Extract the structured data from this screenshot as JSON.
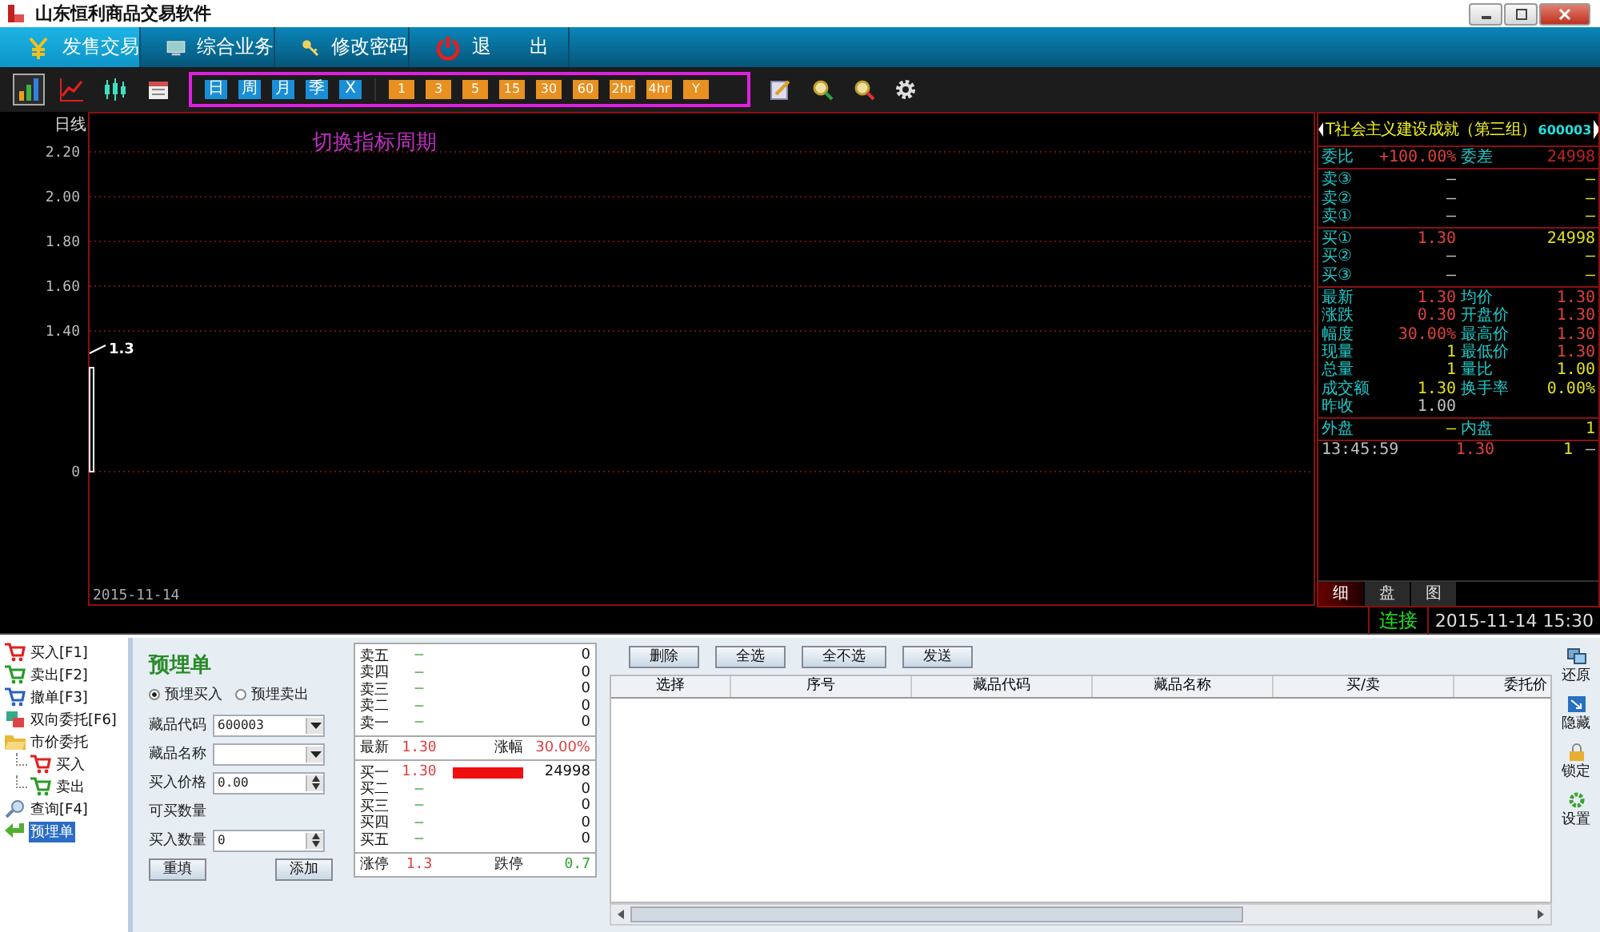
{
  "window": {
    "title": "山东恒利商品交易软件"
  },
  "menu_tabs": [
    {
      "label": "发售交易",
      "kind": "yen",
      "selected": true
    },
    {
      "label": "综合业务",
      "kind": "monitor",
      "selected": false
    },
    {
      "label": "修改密码",
      "kind": "key",
      "selected": false
    },
    {
      "label": "退　　出",
      "kind": "power",
      "selected": false
    }
  ],
  "chart_tools": [
    {
      "kind": "bars",
      "selected": true
    },
    {
      "kind": "line",
      "selected": false
    },
    {
      "kind": "candles",
      "selected": false
    },
    {
      "kind": "calendar",
      "selected": false
    }
  ],
  "periods": [
    {
      "label": "日",
      "kind": "date"
    },
    {
      "label": "周",
      "kind": "date"
    },
    {
      "label": "月",
      "kind": "date"
    },
    {
      "label": "季",
      "kind": "date"
    },
    {
      "label": "X",
      "kind": "date"
    },
    {
      "label": "1",
      "kind": "minute"
    },
    {
      "label": "3",
      "kind": "minute"
    },
    {
      "label": "5",
      "kind": "minute"
    },
    {
      "label": "15",
      "kind": "minute"
    },
    {
      "label": "30",
      "kind": "minute"
    },
    {
      "label": "60",
      "kind": "minute"
    },
    {
      "label": "2hr",
      "kind": "minute"
    },
    {
      "label": "4hr",
      "kind": "minute"
    },
    {
      "label": "Y",
      "kind": "minute"
    }
  ],
  "chart": {
    "period_label": "日线",
    "annotation": "切换指标周期",
    "y_labels": [
      "2.20",
      "2.00",
      "1.80",
      "1.60",
      "1.40",
      "0"
    ],
    "price_label": "1.3",
    "date_label": "2015-11-14"
  },
  "quote": {
    "name": "T社会主义建设成就（第三组）",
    "code": "600003",
    "sections": [
      [
        {
          "label": "委比",
          "value": {
            "text": "+100.00%",
            "kind": "price"
          },
          "label2": "委差",
          "value2": {
            "text": "24998",
            "kind": "diff"
          }
        }
      ],
      [
        {
          "label": "卖③",
          "value": {
            "text": "—",
            "kind": "plain"
          },
          "value2": {
            "text": "—",
            "kind": "volume"
          }
        },
        {
          "label": "卖②",
          "value": {
            "text": "—",
            "kind": "plain"
          },
          "value2": {
            "text": "—",
            "kind": "volume"
          }
        },
        {
          "label": "卖①",
          "value": {
            "text": "—",
            "kind": "plain"
          },
          "value2": {
            "text": "—",
            "kind": "volume"
          }
        }
      ],
      [
        {
          "label": "买①",
          "value": {
            "text": "1.30",
            "kind": "price"
          },
          "value2": {
            "text": "24998",
            "kind": "volume"
          }
        },
        {
          "label": "买②",
          "value": {
            "text": "—",
            "kind": "plain"
          },
          "value2": {
            "text": "—",
            "kind": "volume"
          }
        },
        {
          "label": "买③",
          "value": {
            "text": "—",
            "kind": "plain"
          },
          "value2": {
            "text": "—",
            "kind": "volume"
          }
        }
      ],
      [
        {
          "label": "最新",
          "value": {
            "text": "1.30",
            "kind": "price"
          },
          "label2": "均价",
          "value2": {
            "text": "1.30",
            "kind": "price"
          }
        },
        {
          "label": "涨跌",
          "value": {
            "text": "0.30",
            "kind": "price"
          },
          "label2": "开盘价",
          "value2": {
            "text": "1.30",
            "kind": "price"
          }
        },
        {
          "label": "幅度",
          "value": {
            "text": "30.00%",
            "kind": "price"
          },
          "label2": "最高价",
          "value2": {
            "text": "1.30",
            "kind": "price"
          }
        },
        {
          "label": "现量",
          "value": {
            "text": "1",
            "kind": "volume"
          },
          "label2": "最低价",
          "value2": {
            "text": "1.30",
            "kind": "price"
          }
        },
        {
          "label": "总量",
          "value": {
            "text": "1",
            "kind": "volume"
          },
          "label2": "量比",
          "value2": {
            "text": "1.00",
            "kind": "volume"
          }
        },
        {
          "label": "成交额",
          "value": {
            "text": "1.30",
            "kind": "volume"
          },
          "label2": "换手率",
          "value2": {
            "text": "0.00%",
            "kind": "volume"
          }
        },
        {
          "label": "昨收",
          "value": {
            "text": "1.00",
            "kind": "plain"
          }
        }
      ],
      [
        {
          "label": "外盘",
          "value": {
            "text": "—",
            "kind": "volume"
          },
          "label2": "内盘",
          "value2": {
            "text": "1",
            "kind": "volume"
          }
        }
      ]
    ],
    "ticks": [
      {
        "time": "13:45:59",
        "price": "1.30",
        "volume": "1",
        "flag": "—"
      }
    ],
    "tabs": [
      {
        "label": "细",
        "selected": true
      },
      {
        "label": "盘",
        "selected": false
      },
      {
        "label": "图",
        "selected": false
      }
    ]
  },
  "status": {
    "connection": "连接",
    "datetime": "2015-11-14 15:30"
  },
  "nav": [
    {
      "label": "买入[F1]",
      "kind": "cart-buy",
      "selected": false
    },
    {
      "label": "卖出[F2]",
      "kind": "cart-sell",
      "selected": false
    },
    {
      "label": "撤单[F3]",
      "kind": "cart-cancel",
      "selected": false
    },
    {
      "label": "双向委托[F6]",
      "kind": "swap",
      "selected": false
    },
    {
      "label": "市价委托",
      "kind": "folder",
      "selected": false,
      "expanded": true,
      "children": [
        {
          "label": "买入",
          "kind": "cart-buy",
          "selected": false
        },
        {
          "label": "卖出",
          "kind": "cart-sell",
          "selected": false
        }
      ]
    },
    {
      "label": "查询[F4]",
      "kind": "search",
      "selected": false
    },
    {
      "label": "预埋单",
      "kind": "arrow",
      "selected": true
    }
  ],
  "form": {
    "title": "预埋单",
    "radios": [
      {
        "label": "预埋买入",
        "selected": true
      },
      {
        "label": "预埋卖出",
        "selected": false
      }
    ],
    "fields": [
      {
        "label": "藏品代码",
        "kind": "dropdown",
        "value": "600003"
      },
      {
        "label": "藏品名称",
        "kind": "dropdown"
      },
      {
        "label": "买入价格",
        "kind": "spinner",
        "value": "0.00"
      },
      {
        "label": "可买数量",
        "kind": "text"
      },
      {
        "label": "买入数量",
        "kind": "spinner",
        "value": "0"
      }
    ],
    "buttons": [
      "重填",
      "添加"
    ]
  },
  "book": {
    "sells": [
      {
        "label": "卖五",
        "price": "–",
        "volume": "0"
      },
      {
        "label": "卖四",
        "price": "–",
        "volume": "0"
      },
      {
        "label": "卖三",
        "price": "–",
        "volume": "0"
      },
      {
        "label": "卖二",
        "price": "–",
        "volume": "0"
      },
      {
        "label": "卖一",
        "price": "–",
        "volume": "0"
      }
    ],
    "latest": {
      "label": "最新",
      "price": "1.30",
      "change_label": "涨幅",
      "change": "30.00%"
    },
    "buys": [
      {
        "label": "买一",
        "price": "1.30",
        "volume": "24998",
        "bar": true
      },
      {
        "label": "买二",
        "price": "–",
        "volume": "0",
        "bar": false
      },
      {
        "label": "买三",
        "price": "–",
        "volume": "0",
        "bar": false
      },
      {
        "label": "买四",
        "price": "–",
        "volume": "0",
        "bar": false
      },
      {
        "label": "买五",
        "price": "–",
        "volume": "0",
        "bar": false
      }
    ],
    "limit_up_label": "涨停",
    "limit_up": "1.3",
    "limit_down_label": "跌停",
    "limit_down": "0.7"
  },
  "orders": {
    "buttons": [
      "删除",
      "全选",
      "全不选",
      "发送"
    ],
    "columns": [
      "选择",
      "序号",
      "藏品代码",
      "藏品名称",
      "买/卖",
      "委托价"
    ]
  },
  "side_tools": [
    {
      "label": "还原",
      "kind": "restore"
    },
    {
      "label": "隐藏",
      "kind": "hide"
    },
    {
      "label": "锁定",
      "kind": "lock"
    },
    {
      "label": "设置",
      "kind": "settings"
    }
  ]
}
